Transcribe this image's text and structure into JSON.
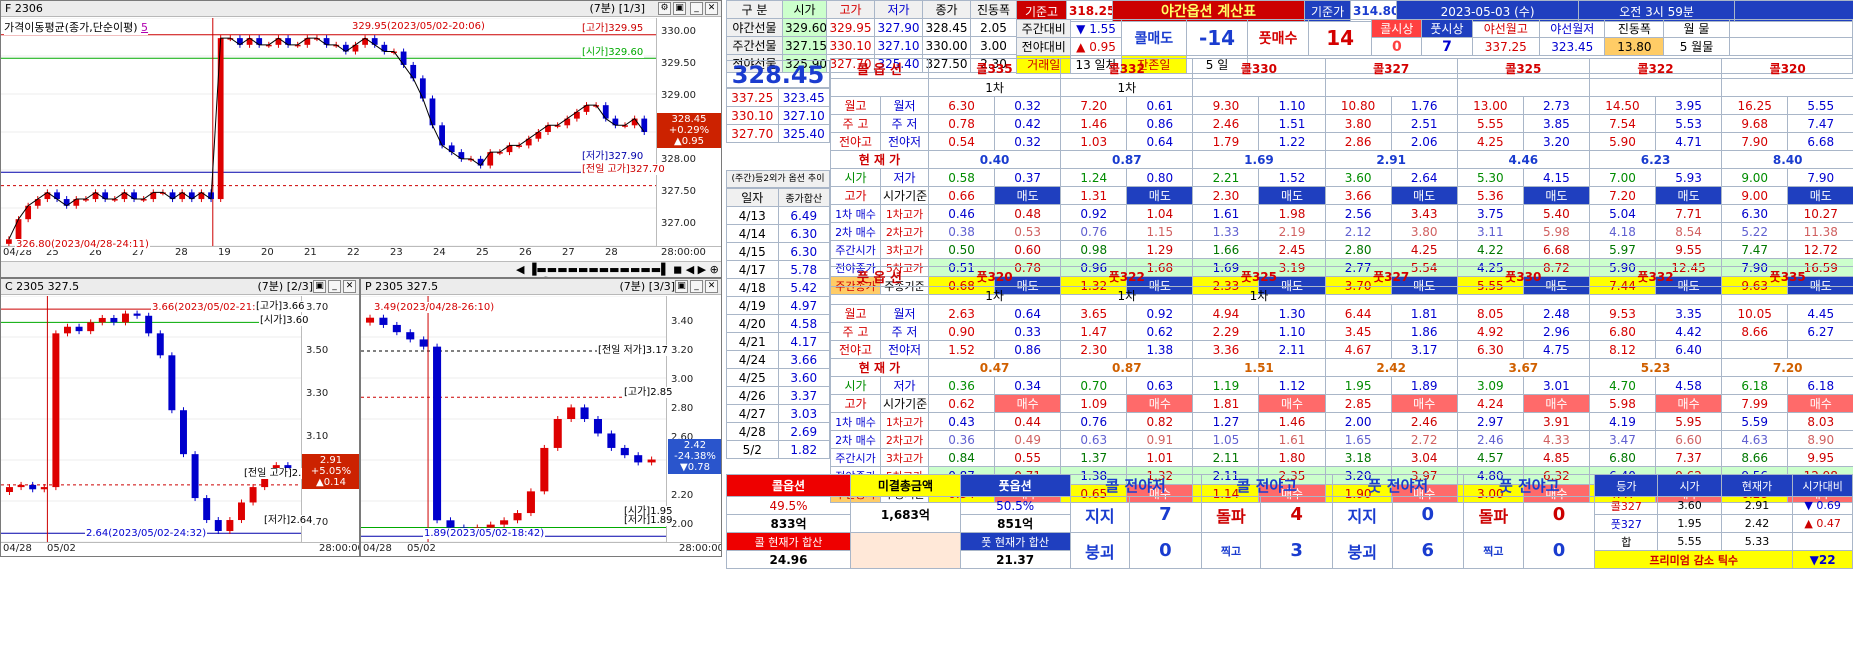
{
  "chart_top": {
    "title": "F 2306",
    "right_title": "(7분) [1/3]",
    "indicator": "가격이동평균(종가,단순이평)",
    "indicator_num": "5",
    "hi_note": "329.95(2023/05/02-20:06)",
    "lo_note": "326.80(2023/04/28-24:11)",
    "ref_lines": [
      {
        "label": "[고가]329.95",
        "v": 329.95,
        "color": "#c00"
      },
      {
        "label": "[시가]329.60",
        "v": 329.6,
        "color": "#0a0"
      },
      {
        "label": "[저가]327.90",
        "v": 327.9,
        "color": "#00a"
      },
      {
        "label": "[전일 고가]327.70",
        "v": 327.7,
        "color": "#c00"
      }
    ],
    "yticks": [
      "330.00",
      "329.50",
      "329.00",
      "328.50",
      "328.00",
      "327.50",
      "327.00"
    ],
    "xticks": [
      "04/28",
      "25",
      "26",
      "27",
      "28",
      "19",
      "20",
      "21",
      "22",
      "23",
      "24",
      "25",
      "26",
      "27",
      "28",
      "28:00:00"
    ],
    "cur": [
      "328.45",
      "+0.29%",
      "▲0.95"
    ],
    "chart_data": {
      "type": "candlestick",
      "ylim": [
        326.8,
        330.2
      ],
      "close": [
        326.9,
        327.2,
        327.4,
        327.5,
        327.6,
        327.5,
        327.4,
        327.5,
        327.5,
        327.6,
        327.5,
        327.5,
        327.6,
        327.5,
        327.5,
        327.6,
        327.6,
        327.5,
        327.6,
        327.5,
        327.6,
        327.5,
        329.9,
        329.9,
        329.8,
        329.9,
        329.8,
        329.8,
        329.9,
        329.8,
        329.8,
        329.9,
        329.9,
        329.8,
        329.8,
        329.7,
        329.8,
        329.9,
        329.8,
        329.7,
        329.7,
        329.5,
        329.3,
        329.0,
        328.6,
        328.3,
        328.2,
        328.1,
        328.1,
        328.0,
        328.2,
        328.2,
        328.3,
        328.3,
        328.4,
        328.5,
        328.6,
        328.6,
        328.7,
        328.8,
        328.9,
        328.9,
        328.7,
        328.6,
        328.6,
        328.7,
        328.5
      ]
    }
  },
  "chart_c": {
    "title": "C 2305 327.5",
    "right_title": "(7분) [2/3]",
    "hi_note": "3.66(2023/05/02-21:58)",
    "lo_note": "2.64(2023/05/02-24:32)",
    "refs": [
      "[고가]3.66",
      "[시가]3.60",
      "[전일 고가]2.86",
      "[저가]2.64"
    ],
    "yticks": [
      "3.70",
      "3.50",
      "3.30",
      "3.10",
      "2.90",
      "2.70"
    ],
    "xticks": [
      "04/28",
      "05/02",
      "28:00:00"
    ],
    "cur": [
      "2.91",
      "+5.05%",
      "▲0.14"
    ],
    "chart_data": {
      "type": "candlestick",
      "ylim": [
        2.6,
        3.72
      ],
      "close": [
        2.85,
        2.86,
        2.84,
        2.85,
        3.55,
        3.58,
        3.56,
        3.6,
        3.62,
        3.6,
        3.64,
        3.63,
        3.55,
        3.45,
        3.2,
        3.0,
        2.8,
        2.7,
        2.65,
        2.7,
        2.78,
        2.85,
        2.9,
        2.95,
        2.91
      ]
    }
  },
  "chart_p": {
    "title": "P 2305 327.5",
    "right_title": "(7분) [3/3]",
    "hi_note": "3.49(2023/04/28-26:10)",
    "lo_note": "1.89(2023/05/02-18:42)",
    "refs": [
      "[전일 저가]3.17",
      "[고가]2.85",
      "[시가]1.95",
      "[저가]1.89"
    ],
    "yticks": [
      "3.40",
      "3.20",
      "3.00",
      "2.80",
      "2.60",
      "2.40",
      "2.20",
      "2.00"
    ],
    "xticks": [
      "04/28",
      "05/02",
      "28:00:00"
    ],
    "cur": [
      "2.42",
      "-24.38%",
      "▼0.78"
    ],
    "chart_data": {
      "type": "candlestick",
      "ylim": [
        1.85,
        3.55
      ],
      "close": [
        3.4,
        3.35,
        3.3,
        3.25,
        3.2,
        2.0,
        1.95,
        1.92,
        1.95,
        1.97,
        2.0,
        2.05,
        2.2,
        2.5,
        2.7,
        2.78,
        2.7,
        2.6,
        2.5,
        2.45,
        2.4,
        2.42
      ]
    }
  },
  "futures": {
    "headers": [
      "구 분",
      "시가",
      "고가",
      "저가",
      "종가",
      "진동폭"
    ],
    "rows": [
      [
        "야간선물",
        "329.60",
        "329.95",
        "327.90",
        "328.45",
        "2.05"
      ],
      [
        "주간선물",
        "327.15",
        "330.10",
        "327.10",
        "330.00",
        "3.00"
      ],
      [
        "전야선물",
        "325.90",
        "327.70",
        "325.40",
        "327.50",
        "2.30"
      ]
    ]
  },
  "top_info": {
    "kijun_label": "기준고",
    "kijun": "318.25",
    "title": "야간옵션 계산표",
    "kijunga_label": "기준가",
    "kijunga": "314.80",
    "date": "2023-05-03 (수)",
    "time": "오전 3시 59분",
    "jugan_label": "주간대비",
    "jugan": "▼ 1.55",
    "jeonya_label": "전야대비",
    "jeonya": "▲ 0.95",
    "call_sell": "콜매도",
    "call_sell_v": "-14",
    "put_buy": "풋매수",
    "put_buy_v": "14",
    "call_start": "콜시상",
    "call_start_v": "0",
    "put_start": "풋시상",
    "put_start_v": "7",
    "ya_wolgo": "야선월고",
    "ya_wolgo_v": "337.25",
    "ya_wolje": "야선월저",
    "ya_wolje_v": "323.45",
    "jindong": "진동폭",
    "jindong_v": "13.80",
    "wolmul": "월 물",
    "wolmul_v": "5 월물",
    "trade_day": "거래일",
    "trade_day_v": "13 일차",
    "remain": "잔존일",
    "remain_v": "5 일"
  },
  "price_box": {
    "price": "328.45",
    "side_rows": [
      [
        "337.25",
        "323.45"
      ],
      [
        "330.10",
        "327.10"
      ],
      [
        "327.70",
        "325.40"
      ]
    ],
    "side_labels": [
      [
        "월 고",
        "월 저"
      ],
      [
        "주 고",
        "주 저"
      ],
      [
        "전야고",
        "전야저"
      ]
    ]
  },
  "call": {
    "label": "콜 옵 션",
    "strikes": [
      "콜335",
      "콜332",
      "콜330",
      "콜327",
      "콜325",
      "콜322",
      "콜320"
    ],
    "cha": [
      "1차",
      "1차"
    ],
    "wol": [
      [
        "6.30",
        "0.32"
      ],
      [
        "7.20",
        "0.61"
      ],
      [
        "9.30",
        "1.10"
      ],
      [
        "10.80",
        "1.76"
      ],
      [
        "13.00",
        "2.73"
      ],
      [
        "14.50",
        "3.95"
      ],
      [
        "16.25",
        "5.55"
      ]
    ],
    "ju": [
      [
        "0.78",
        "0.42"
      ],
      [
        "1.46",
        "0.86"
      ],
      [
        "2.46",
        "1.51"
      ],
      [
        "3.80",
        "2.51"
      ],
      [
        "5.55",
        "3.85"
      ],
      [
        "7.54",
        "5.53"
      ],
      [
        "9.68",
        "7.47"
      ]
    ],
    "jy": [
      [
        "0.54",
        "0.32"
      ],
      [
        "1.03",
        "0.64"
      ],
      [
        "1.79",
        "1.22"
      ],
      [
        "2.86",
        "2.06"
      ],
      [
        "4.25",
        "3.20"
      ],
      [
        "5.90",
        "4.71"
      ],
      [
        "7.90",
        "6.68"
      ]
    ],
    "cur_label": "현 재 가",
    "cur": [
      "0.40",
      "0.87",
      "1.69",
      "2.91",
      "4.46",
      "6.23",
      "8.40"
    ],
    "sj": [
      [
        "0.58",
        "0.37"
      ],
      [
        "1.24",
        "0.80"
      ],
      [
        "2.21",
        "1.52"
      ],
      [
        "3.60",
        "2.64"
      ],
      [
        "5.30",
        "4.15"
      ],
      [
        "7.00",
        "5.93"
      ],
      [
        "9.00",
        "7.90"
      ]
    ],
    "go": [
      "0.66",
      "1.31",
      "2.30",
      "3.66",
      "5.36",
      "7.20",
      "9.00"
    ],
    "b1": [
      [
        "0.46",
        "0.48"
      ],
      [
        "0.92",
        "1.04"
      ],
      [
        "1.61",
        "1.98"
      ],
      [
        "2.56",
        "3.43"
      ],
      [
        "3.75",
        "5.40"
      ],
      [
        "5.04",
        "7.71"
      ],
      [
        "6.30",
        "10.27"
      ]
    ],
    "b2": [
      [
        "0.38",
        "0.53"
      ],
      [
        "0.76",
        "1.15"
      ],
      [
        "1.33",
        "2.19"
      ],
      [
        "2.12",
        "3.80"
      ],
      [
        "3.11",
        "5.98"
      ],
      [
        "4.18",
        "8.54"
      ],
      [
        "5.22",
        "11.38"
      ]
    ],
    "js": [
      [
        "0.50",
        "0.60"
      ],
      [
        "0.98",
        "1.29"
      ],
      [
        "1.66",
        "2.45"
      ],
      [
        "2.80",
        "4.25"
      ],
      [
        "4.22",
        "6.68"
      ],
      [
        "5.97",
        "9.55"
      ],
      [
        "7.47",
        "12.72"
      ]
    ],
    "jyj": [
      [
        "0.51",
        "0.78"
      ],
      [
        "0.96",
        "1.68"
      ],
      [
        "1.69",
        "3.19"
      ],
      [
        "2.77",
        "5.54"
      ],
      [
        "4.25",
        "8.72"
      ],
      [
        "5.90",
        "12.45"
      ],
      [
        "7.90",
        "16.59"
      ]
    ],
    "jgj": [
      "0.68",
      "1.32",
      "2.33",
      "3.70",
      "5.55",
      "7.44",
      "9.63"
    ]
  },
  "put": {
    "label": "풋 옵 션",
    "strikes": [
      "풋320",
      "풋322",
      "풋325",
      "풋327",
      "풋330",
      "풋332",
      "풋335"
    ],
    "cha": [
      "1차",
      "1차",
      "1차"
    ],
    "wol": [
      [
        "2.63",
        "0.64"
      ],
      [
        "3.65",
        "0.92"
      ],
      [
        "4.94",
        "1.30"
      ],
      [
        "6.44",
        "1.81"
      ],
      [
        "8.05",
        "2.48"
      ],
      [
        "9.53",
        "3.35"
      ],
      [
        "10.05",
        "4.45"
      ]
    ],
    "ju": [
      [
        "0.90",
        "0.33"
      ],
      [
        "1.47",
        "0.62"
      ],
      [
        "2.29",
        "1.10"
      ],
      [
        "3.45",
        "1.86"
      ],
      [
        "4.92",
        "2.96"
      ],
      [
        "6.80",
        "4.42"
      ],
      [
        "8.66",
        "6.27"
      ]
    ],
    "jy": [
      [
        "1.52",
        "0.86"
      ],
      [
        "2.30",
        "1.38"
      ],
      [
        "3.36",
        "2.11"
      ],
      [
        "4.67",
        "3.17"
      ],
      [
        "6.30",
        "4.75"
      ],
      [
        "8.12",
        "6.40"
      ],
      [
        "",
        ""
      ]
    ],
    "cur_label": "현 재 가",
    "cur": [
      "0.47",
      "0.87",
      "1.51",
      "2.42",
      "3.67",
      "5.23",
      "7.20"
    ],
    "sj": [
      [
        "0.36",
        "0.34"
      ],
      [
        "0.70",
        "0.63"
      ],
      [
        "1.19",
        "1.12"
      ],
      [
        "1.95",
        "1.89"
      ],
      [
        "3.09",
        "3.01"
      ],
      [
        "4.70",
        "4.58"
      ],
      [
        "6.18",
        "6.18"
      ]
    ],
    "go": [
      "0.62",
      "1.09",
      "1.81",
      "2.85",
      "4.24",
      "5.98",
      "7.99"
    ],
    "b1": [
      [
        "0.43",
        "0.44"
      ],
      [
        "0.76",
        "0.82"
      ],
      [
        "1.27",
        "1.46"
      ],
      [
        "2.00",
        "2.46"
      ],
      [
        "2.97",
        "3.91"
      ],
      [
        "4.19",
        "5.95"
      ],
      [
        "5.59",
        "8.03"
      ]
    ],
    "b2": [
      [
        "0.36",
        "0.49"
      ],
      [
        "0.63",
        "0.91"
      ],
      [
        "1.05",
        "1.61"
      ],
      [
        "1.65",
        "2.72"
      ],
      [
        "2.46",
        "4.33"
      ],
      [
        "3.47",
        "6.60"
      ],
      [
        "4.63",
        "8.90"
      ]
    ],
    "js": [
      [
        "0.84",
        "0.55"
      ],
      [
        "1.37",
        "1.01"
      ],
      [
        "2.11",
        "1.80"
      ],
      [
        "3.18",
        "3.04"
      ],
      [
        "4.57",
        "4.85"
      ],
      [
        "6.80",
        "7.37"
      ],
      [
        "8.66",
        "9.95"
      ]
    ],
    "jyj": [
      [
        "0.87",
        "0.71"
      ],
      [
        "1.38",
        "1.32"
      ],
      [
        "2.11",
        "2.35"
      ],
      [
        "3.20",
        "3.97"
      ],
      [
        "4.80",
        "6.32"
      ],
      [
        "6.40",
        "9.62"
      ],
      [
        "9.56",
        "12.98"
      ]
    ],
    "jgj": [
      "0.34",
      "0.65",
      "1.14",
      "1.90",
      "3.00",
      "4.47",
      "6.28"
    ]
  },
  "labels": {
    "siga": "시가",
    "jeoga": "저가",
    "goga": "고가",
    "siga_base": "시가기준",
    "b1": "1차 매수",
    "b1r": "1차고가",
    "b2": "2차 매수",
    "b2r": "2차고가",
    "js": "주간시가",
    "jsr": "3차고가",
    "jyj": "전야종가",
    "jyjr": "5차고가",
    "jgj": "주간종가",
    "jgjr": "주종기준",
    "sell": "매도",
    "buy": "매수",
    "trend_title": "(주간)등2외가 옵션 추이",
    "day": "일자",
    "sum": "종가합산"
  },
  "trend": [
    [
      "4/13",
      "6.49"
    ],
    [
      "4/14",
      "6.30"
    ],
    [
      "4/15",
      "6.30"
    ],
    [
      "4/17",
      "5.78"
    ],
    [
      "4/18",
      "5.42"
    ],
    [
      "4/19",
      "4.97"
    ],
    [
      "4/20",
      "4.58"
    ],
    [
      "4/21",
      "4.17"
    ],
    [
      "4/24",
      "3.66"
    ],
    [
      "4/25",
      "3.60"
    ],
    [
      "4/26",
      "3.37"
    ],
    [
      "4/27",
      "3.03"
    ],
    [
      "4/28",
      "2.69"
    ],
    [
      "5/2",
      "1.82"
    ]
  ],
  "bottom": {
    "call_opt": "콜옵션",
    "call_pct": "49.5%",
    "call_amt": "833억",
    "mi_label": "미결총금액",
    "mi_amt": "1,683억",
    "put_opt": "풋옵션",
    "put_pct": "50.5%",
    "put_amt": "851억",
    "call_sum_label": "콜 현재가 합산",
    "call_sum": "24.96",
    "put_sum_label": "풋 현재가 합산",
    "put_sum": "21.37",
    "call_jy_low": "콜 전야저",
    "call_jy_high": "콜 전야고",
    "put_jy_low": "풋 전야저",
    "put_jy_high": "풋 전야고",
    "jiji": "지지",
    "dolpa": "돌파",
    "bunggoe": "붕괴",
    "jjikgo": "찍고",
    "bungoe2": "붕괴",
    "v": [
      "7",
      "4",
      "0",
      "0",
      "0",
      "3",
      "6",
      "0"
    ]
  },
  "mini": {
    "headers": [
      "등가",
      "시가",
      "현재가",
      "시가대비"
    ],
    "rows": [
      [
        "콜327",
        "3.60",
        "2.91",
        "▼ 0.69"
      ],
      [
        "풋327",
        "1.95",
        "2.42",
        "▲ 0.47"
      ],
      [
        "합",
        "5.55",
        "5.33",
        ""
      ]
    ],
    "footer": "프리미엄 감소 틱수",
    "footer_v": "▼22"
  }
}
